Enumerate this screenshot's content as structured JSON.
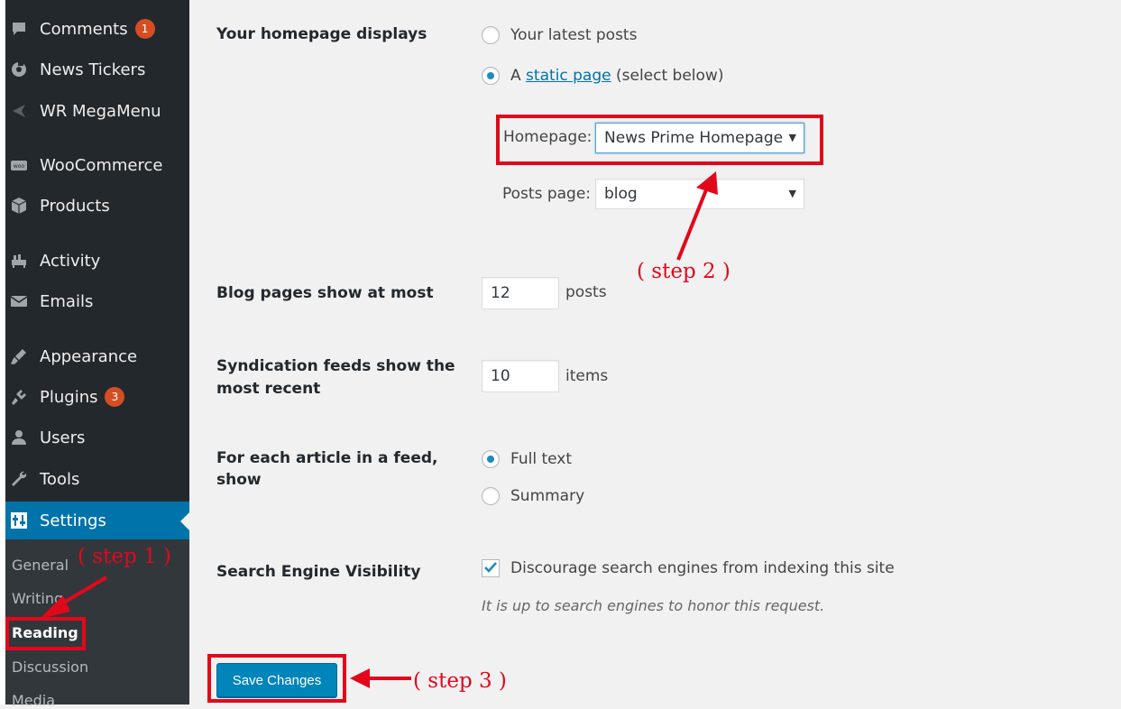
{
  "sidebar": {
    "menu": [
      {
        "label": "Comments",
        "icon": "comment-icon",
        "badge": "1"
      },
      {
        "label": "News Tickers",
        "icon": "ticker-icon",
        "badge": null
      },
      {
        "label": "WR MegaMenu",
        "icon": "megamenu-icon",
        "badge": null
      },
      {
        "label": "WooCommerce",
        "icon": "woocommerce-icon",
        "badge": null
      },
      {
        "label": "Products",
        "icon": "products-icon",
        "badge": null
      },
      {
        "label": "Activity",
        "icon": "activity-icon",
        "badge": null
      },
      {
        "label": "Emails",
        "icon": "email-icon",
        "badge": null
      },
      {
        "label": "Appearance",
        "icon": "appearance-icon",
        "badge": null
      },
      {
        "label": "Plugins",
        "icon": "plugins-icon",
        "badge": "3"
      },
      {
        "label": "Users",
        "icon": "users-icon",
        "badge": null
      },
      {
        "label": "Tools",
        "icon": "tools-icon",
        "badge": null
      },
      {
        "label": "Settings",
        "icon": "settings-icon",
        "badge": null,
        "active": true
      }
    ],
    "submenu": [
      {
        "label": "General"
      },
      {
        "label": "Writing"
      },
      {
        "label": "Reading",
        "current": true
      },
      {
        "label": "Discussion"
      },
      {
        "label": "Media"
      }
    ]
  },
  "settings": {
    "homepage_displays": {
      "label": "Your homepage displays",
      "option_latest": "Your latest posts",
      "option_static_prefix": "A",
      "option_static_link": "static page",
      "option_static_suffix": "(select below)",
      "selected": "static"
    },
    "homepage_select": {
      "label": "Homepage:",
      "value": "News Prime Homepage"
    },
    "posts_page_select": {
      "label": "Posts page:",
      "value": "blog"
    },
    "blog_pages": {
      "label": "Blog pages show at most",
      "value": "12",
      "unit": "posts"
    },
    "syndication": {
      "label_line1": "Syndication feeds show the",
      "label_line2": "most recent",
      "value": "10",
      "unit": "items"
    },
    "feed_article": {
      "label_line1": "For each article in a feed,",
      "label_line2": "show",
      "option_full": "Full text",
      "option_summary": "Summary",
      "selected": "full"
    },
    "search_visibility": {
      "label": "Search Engine Visibility",
      "checkbox_label": "Discourage search engines from indexing this site",
      "checked": true,
      "description": "It is up to search engines to honor this request."
    },
    "save_button": "Save Changes"
  },
  "annotations": {
    "step1": "( step 1 )",
    "step2": "( step 2 )",
    "step3": "( step 3 )",
    "color": "#e2081b"
  },
  "colors": {
    "sidebar_bg": "#23282d",
    "submenu_bg": "#32373c",
    "active": "#0073aa",
    "button": "#0085ba",
    "badge": "#d54e21"
  }
}
